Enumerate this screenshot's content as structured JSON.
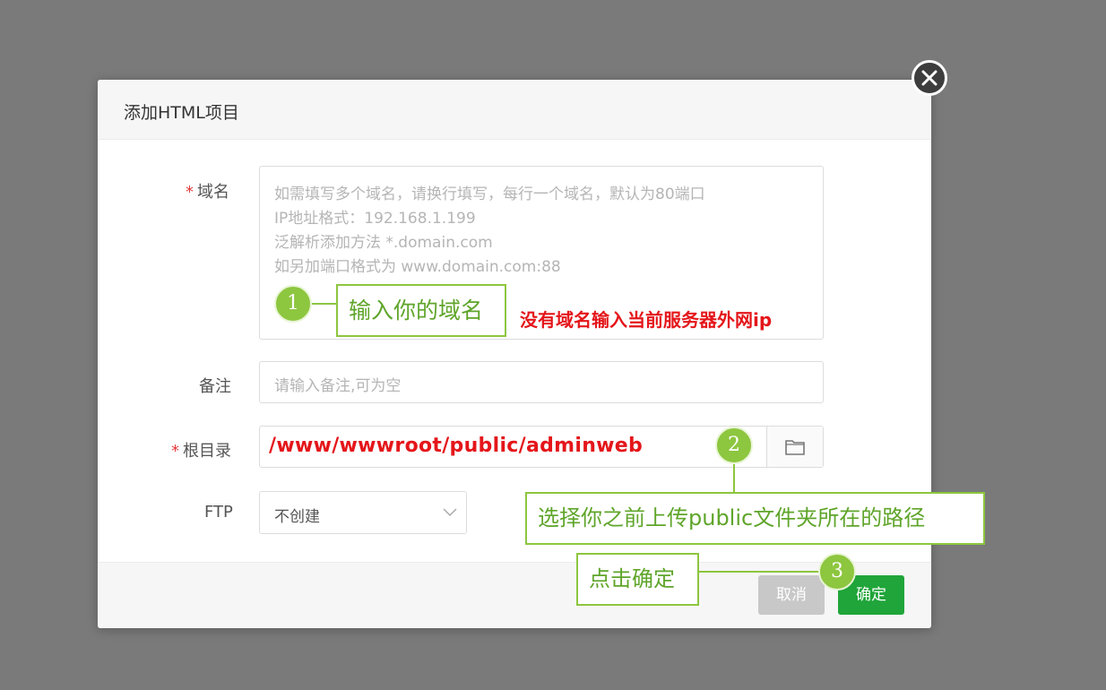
{
  "dialog": {
    "title": "添加HTML项目",
    "close_icon": "close-icon"
  },
  "form": {
    "domain": {
      "required_mark": "*",
      "label": "域名",
      "placeholder_lines": [
        "如需填写多个域名，请换行填写，每行一个域名，默认为80端口",
        "IP地址格式：192.168.1.199",
        "泛解析添加方法 *.domain.com",
        "如另加端口格式为 www.domain.com:88"
      ]
    },
    "remark": {
      "label": "备注",
      "placeholder": "请输入备注,可为空"
    },
    "root": {
      "required_mark": "*",
      "label": "根目录",
      "value": "/www/wwwroot/public/adminweb",
      "folder_icon": "folder-icon"
    },
    "ftp": {
      "label": "FTP",
      "selected": "不创建"
    }
  },
  "footer": {
    "cancel_label": "取消",
    "ok_label": "确定"
  },
  "annotations": {
    "step1": {
      "number": "1",
      "text": "输入你的域名"
    },
    "step1_note": "没有域名输入当前服务器外网ip",
    "step2": {
      "number": "2",
      "text": "选择你之前上传public文件夹所在的路径"
    },
    "step3": {
      "number": "3",
      "text": "点击确定"
    }
  },
  "colors": {
    "overlay": "#7a7a7a",
    "primary_green": "#20a53a",
    "annotation_green": "#8dc63f",
    "annotation_red": "#e4161a"
  }
}
